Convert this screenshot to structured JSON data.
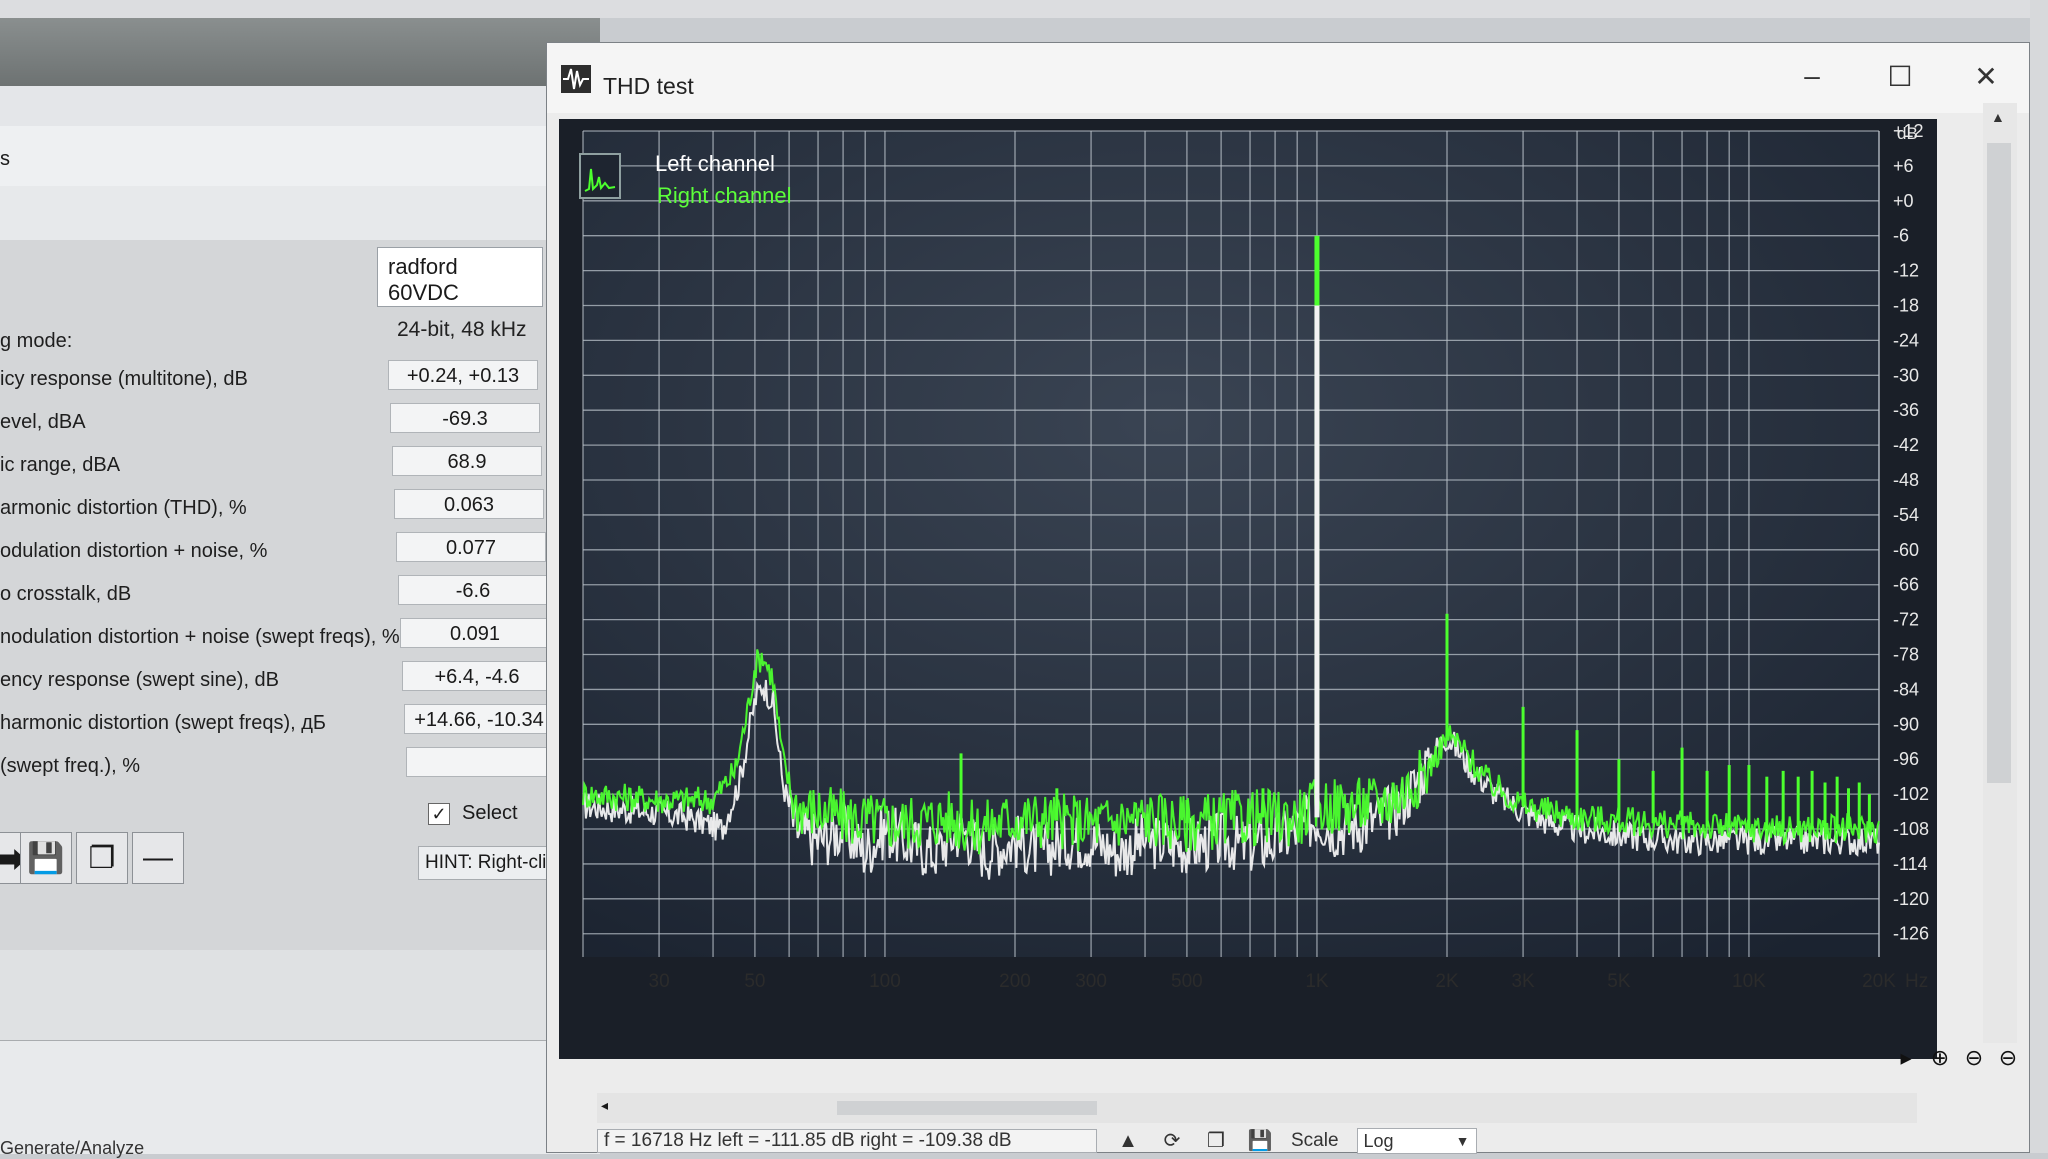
{
  "background_app": {
    "section_label": "s",
    "profile_name": "radford 60VDC",
    "mode_label": "g mode:",
    "mode_value": "24-bit, 48 kHz",
    "results": [
      {
        "label": "icy response (multitone), dB",
        "value": "+0.24, +0.13"
      },
      {
        "label": "evel, dBA",
        "value": "-69.3"
      },
      {
        "label": "ic range, dBA",
        "value": "68.9"
      },
      {
        "label": "armonic distortion (THD), %",
        "value": "0.063"
      },
      {
        "label": "odulation distortion + noise, %",
        "value": "0.077"
      },
      {
        "label": "o crosstalk, dB",
        "value": "-6.6"
      },
      {
        "label": "nodulation distortion + noise (swept freqs), %",
        "value": "0.091"
      },
      {
        "label": "ency response (swept sine), dB",
        "value": "+6.4, -4.6"
      },
      {
        "label": "harmonic distortion (swept freqs), дБ",
        "value": "+14.66, -10.34"
      },
      {
        "label": "(swept freq.), %",
        "value": ""
      }
    ],
    "select_label": "Select",
    "select_checked": true,
    "hint_text": "HINT: Right-click",
    "bottom_tab": "Generate/Analyze"
  },
  "window": {
    "title": "THD test",
    "minimize_icon": "minimize-icon",
    "maximize_icon": "maximize-icon",
    "close_icon": "close-icon"
  },
  "legend": {
    "left": "Left channel",
    "right": "Right channel"
  },
  "status": {
    "readout": "f = 16718 Hz   left = -111.85 dB   right = -109.38 dB",
    "scale_label": "Scale",
    "scale_value": "Log"
  },
  "colors": {
    "plot_background": "#1b2330",
    "grid": "#b9c1c9",
    "left_channel": "#f2f2f2",
    "right_channel": "#4cff2e"
  },
  "chart_data": {
    "type": "line",
    "title": "",
    "xlabel": "Hz",
    "ylabel": "dB",
    "x_scale": "log",
    "y_unit": "dB",
    "xlim": [
      20,
      20000
    ],
    "ylim": [
      -130,
      12
    ],
    "x_tick_labels": [
      "30",
      "50",
      "100",
      "200",
      "300",
      "500",
      "1K",
      "2K",
      "3K",
      "5K",
      "10K",
      "20K"
    ],
    "x_ticks": [
      30,
      50,
      100,
      200,
      300,
      500,
      1000,
      2000,
      3000,
      5000,
      10000,
      20000
    ],
    "y_tick_labels": [
      "+12",
      "+6",
      "+0",
      "-6",
      "-12",
      "-18",
      "-24",
      "-30",
      "-36",
      "-42",
      "-48",
      "-54",
      "-60",
      "-66",
      "-72",
      "-78",
      "-84",
      "-90",
      "-96",
      "-102",
      "-108",
      "-114",
      "-120",
      "-126"
    ],
    "y_ticks": [
      12,
      6,
      0,
      -6,
      -12,
      -18,
      -24,
      -30,
      -36,
      -42,
      -48,
      -54,
      -60,
      -66,
      -72,
      -78,
      -84,
      -90,
      -96,
      -102,
      -108,
      -114,
      -120,
      -126
    ],
    "grid": true,
    "legend_position": "top-left",
    "series": [
      {
        "name": "Left channel",
        "color": "#f2f2f2",
        "points": [
          [
            20,
            -104
          ],
          [
            28,
            -105
          ],
          [
            35,
            -106
          ],
          [
            42,
            -108
          ],
          [
            46,
            -100
          ],
          [
            50,
            -86
          ],
          [
            52,
            -83
          ],
          [
            55,
            -86
          ],
          [
            58,
            -100
          ],
          [
            62,
            -108
          ],
          [
            70,
            -110
          ],
          [
            80,
            -108
          ],
          [
            90,
            -112
          ],
          [
            100,
            -108
          ],
          [
            110,
            -110
          ],
          [
            130,
            -112
          ],
          [
            150,
            -108
          ],
          [
            170,
            -112
          ],
          [
            200,
            -110
          ],
          [
            230,
            -112
          ],
          [
            260,
            -110
          ],
          [
            300,
            -110
          ],
          [
            350,
            -112
          ],
          [
            400,
            -110
          ],
          [
            500,
            -111
          ],
          [
            600,
            -110
          ],
          [
            700,
            -111
          ],
          [
            800,
            -110
          ],
          [
            900,
            -108
          ],
          [
            1000,
            -106
          ],
          [
            1100,
            -108
          ],
          [
            1300,
            -107
          ],
          [
            1500,
            -105
          ],
          [
            1700,
            -100
          ],
          [
            1850,
            -95
          ],
          [
            2000,
            -92
          ],
          [
            2100,
            -94
          ],
          [
            2300,
            -98
          ],
          [
            2600,
            -102
          ],
          [
            3000,
            -105
          ],
          [
            3500,
            -107
          ],
          [
            4000,
            -108
          ],
          [
            5000,
            -109
          ],
          [
            7000,
            -110
          ],
          [
            10000,
            -110
          ],
          [
            14000,
            -110
          ],
          [
            20000,
            -110
          ]
        ]
      },
      {
        "name": "Right channel",
        "color": "#4cff2e",
        "points": [
          [
            20,
            -102
          ],
          [
            30,
            -103
          ],
          [
            40,
            -103
          ],
          [
            45,
            -98
          ],
          [
            48,
            -88
          ],
          [
            50,
            -80
          ],
          [
            52,
            -78
          ],
          [
            55,
            -82
          ],
          [
            58,
            -96
          ],
          [
            62,
            -104
          ],
          [
            80,
            -106
          ],
          [
            110,
            -107
          ],
          [
            140,
            -106
          ],
          [
            160,
            -108
          ],
          [
            200,
            -106
          ],
          [
            300,
            -107
          ],
          [
            400,
            -106
          ],
          [
            500,
            -107
          ],
          [
            700,
            -106
          ],
          [
            900,
            -106
          ],
          [
            1000,
            -104
          ],
          [
            1200,
            -104
          ],
          [
            1500,
            -103
          ],
          [
            1800,
            -98
          ],
          [
            2000,
            -92
          ],
          [
            2100,
            -93
          ],
          [
            2500,
            -100
          ],
          [
            3000,
            -104
          ],
          [
            4000,
            -106
          ],
          [
            6000,
            -107
          ],
          [
            10000,
            -108
          ],
          [
            20000,
            -108
          ]
        ]
      }
    ],
    "peaks": [
      {
        "series": "Right channel",
        "x": 1000,
        "y": -6
      },
      {
        "series": "Left channel",
        "x": 1000,
        "y": -18
      },
      {
        "series": "Right channel",
        "x": 2000,
        "y": -71
      },
      {
        "series": "Right channel",
        "x": 3000,
        "y": -87
      },
      {
        "series": "Right channel",
        "x": 4000,
        "y": -91
      },
      {
        "series": "Right channel",
        "x": 5000,
        "y": -96
      },
      {
        "series": "Right channel",
        "x": 6000,
        "y": -98
      },
      {
        "series": "Right channel",
        "x": 7000,
        "y": -94
      },
      {
        "series": "Right channel",
        "x": 8000,
        "y": -98
      },
      {
        "series": "Right channel",
        "x": 9000,
        "y": -97
      },
      {
        "series": "Right channel",
        "x": 10000,
        "y": -97
      },
      {
        "series": "Right channel",
        "x": 11000,
        "y": -99
      },
      {
        "series": "Right channel",
        "x": 12000,
        "y": -98
      },
      {
        "series": "Right channel",
        "x": 13000,
        "y": -99
      },
      {
        "series": "Right channel",
        "x": 14000,
        "y": -98
      },
      {
        "series": "Right channel",
        "x": 15000,
        "y": -100
      },
      {
        "series": "Right channel",
        "x": 16000,
        "y": -99
      },
      {
        "series": "Right channel",
        "x": 17000,
        "y": -101
      },
      {
        "series": "Right channel",
        "x": 18000,
        "y": -100
      },
      {
        "series": "Right channel",
        "x": 19000,
        "y": -102
      },
      {
        "series": "Right channel",
        "x": 150,
        "y": -95
      },
      {
        "series": "Right channel",
        "x": 250,
        "y": -101
      },
      {
        "series": "Right channel",
        "x": 500,
        "y": -103
      },
      {
        "series": "Right channel",
        "x": 750,
        "y": -101
      },
      {
        "series": "Right channel",
        "x": 1250,
        "y": -102
      },
      {
        "series": "Right channel",
        "x": 1500,
        "y": -100
      }
    ]
  }
}
